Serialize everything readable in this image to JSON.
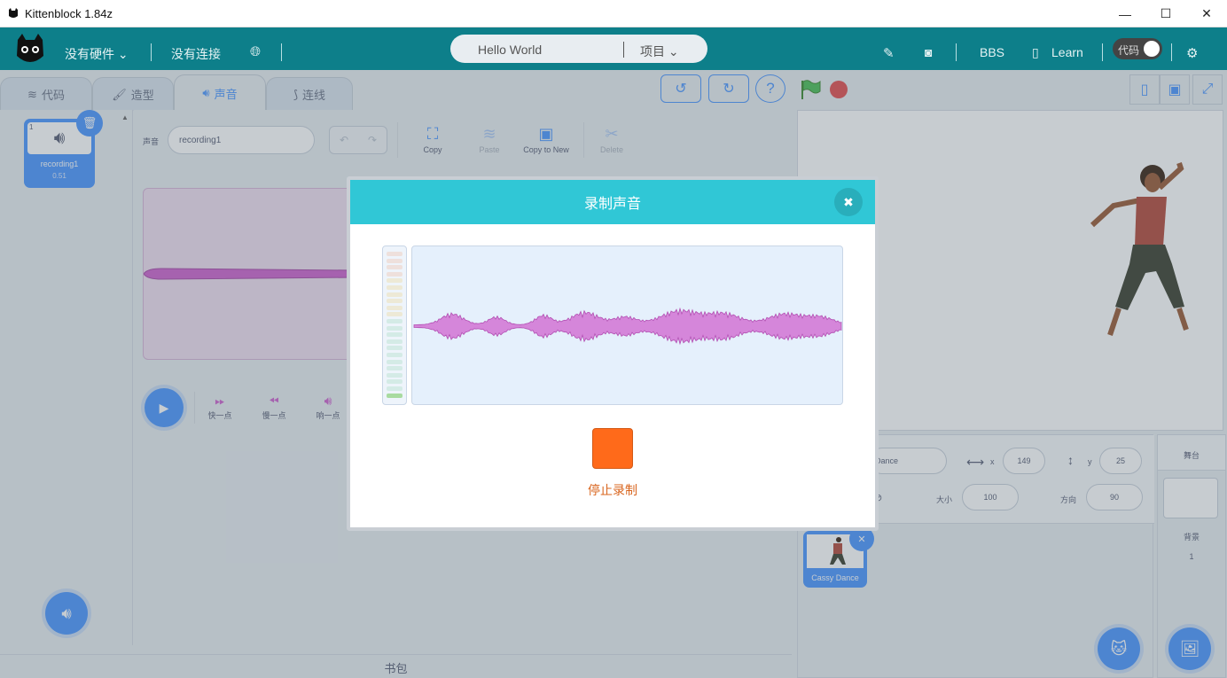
{
  "window": {
    "title": "Kittenblock 1.84z",
    "min": "—",
    "max": "☐",
    "close": "✕"
  },
  "menubar": {
    "hardware": "没有硬件 ⌄",
    "connection": "没有连接",
    "project_name": "Hello World",
    "project_menu": "项目 ⌄",
    "bbs": "BBS",
    "learn": "Learn",
    "code_toggle": "代码"
  },
  "tabs": [
    {
      "label": "代码",
      "icon": "code-icon"
    },
    {
      "label": "造型",
      "icon": "brush-icon"
    },
    {
      "label": "声音",
      "icon": "speaker-icon"
    },
    {
      "label": "连线",
      "icon": "wiring-icon"
    }
  ],
  "sound_list": {
    "items": [
      {
        "index": "1",
        "name": "recording1",
        "duration": "0.51"
      }
    ]
  },
  "editor": {
    "sound_label": "声音",
    "sound_name": "recording1",
    "tools": {
      "copy": "Copy",
      "paste": "Paste",
      "copy_to_new": "Copy to New",
      "delete": "Delete"
    },
    "effects": {
      "faster": "快一点",
      "slower": "慢一点",
      "louder": "响一点"
    }
  },
  "backpack": "书包",
  "sprite_info": {
    "name_value": "Dance",
    "x_label": "x",
    "x_value": "149",
    "y_label": "y",
    "y_value": "25",
    "size_label": "大小",
    "size_value": "100",
    "direction_label": "方向",
    "direction_value": "90",
    "sprites": [
      {
        "name": "Cassy Dance"
      }
    ]
  },
  "stage_pane": {
    "header": "舞台",
    "backdrop_label": "背景",
    "backdrop_count": "1"
  },
  "modal": {
    "title": "录制声音",
    "stop_label": "停止录制",
    "close": "✖"
  },
  "colors": {
    "teal_header": "#0d7f8a",
    "modal_header": "#30c7d6",
    "accent": "#4c97ff",
    "wave": "#cf63cf",
    "stop": "#ff6a1a"
  }
}
